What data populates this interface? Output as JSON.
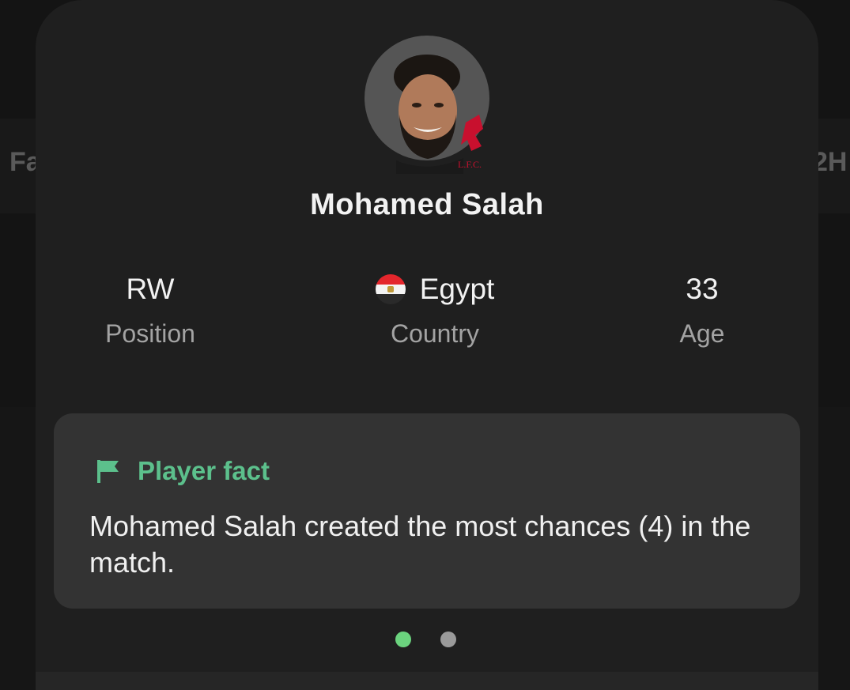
{
  "background": {
    "left_text": "Fa",
    "right_text": "2H"
  },
  "player": {
    "name": "Mohamed Salah",
    "avatar_icon": "player-avatar",
    "club_badge_text": "L.F.C."
  },
  "stats": [
    {
      "value": "RW",
      "label": "Position"
    },
    {
      "value": "Egypt",
      "label": "Country",
      "icon": "egypt-flag-icon"
    },
    {
      "value": "33",
      "label": "Age"
    }
  ],
  "fact": {
    "title": "Player fact",
    "icon": "flag-icon",
    "text": "Mohamed Salah created the most chances (4) in the match."
  },
  "pager": {
    "active_index": 0,
    "count": 2
  },
  "colors": {
    "accent_green": "#5cc08c",
    "dot_active": "#6bd37e",
    "dot_inactive": "#9a9a9a",
    "sheet_bg": "#1f1f1f",
    "card_bg": "#333333"
  }
}
